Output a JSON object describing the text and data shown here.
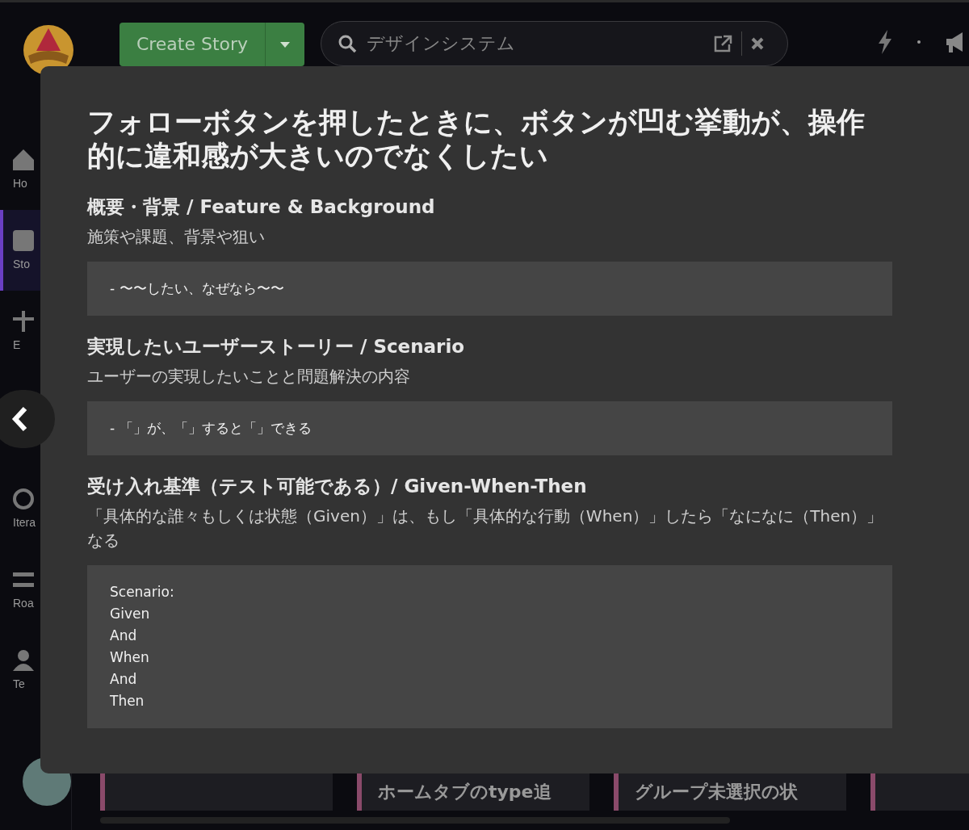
{
  "topbar": {
    "create_button": "Create Story",
    "search": {
      "value": "デザインシステム"
    }
  },
  "sidebar": {
    "items": [
      {
        "label": "Ho",
        "selected": false
      },
      {
        "label": "Sto",
        "selected": true
      },
      {
        "label": "E",
        "selected": false
      },
      {
        "label": "Itera",
        "selected": false
      },
      {
        "label": "Roa",
        "selected": false
      },
      {
        "label": "Te",
        "selected": false
      }
    ]
  },
  "board": {
    "cards": [
      {
        "kind": "blank"
      },
      {
        "kind": "titled",
        "title": "ホームタブのtype追"
      },
      {
        "kind": "titled",
        "title": "グループ未選択の状"
      },
      {
        "kind": "blank"
      }
    ]
  },
  "story": {
    "title": "フォローボタンを押したときに、ボタンが凹む挙動が、操作的に違和感が大きいのでなくしたい",
    "sections": [
      {
        "heading": "概要・背景 / Feature & Background",
        "description": "施策や課題、背景や狙い",
        "lines": [
          "- 〜〜したい、なぜなら〜〜"
        ]
      },
      {
        "heading": "実現したいユーザーストーリー / Scenario",
        "description": "ユーザーの実現したいことと問題解決の内容",
        "lines": [
          "- 「」が、「」すると「」できる"
        ]
      },
      {
        "heading": "受け入れ基準（テスト可能である）/ Given-When-Then",
        "description": "「具体的な誰々もしくは状態（Given）」は、もし「具体的な行動（When）」したら「なになに（Then）」なる",
        "lines": [
          "Scenario:",
          "Given",
          "And",
          "When",
          "And",
          "Then"
        ]
      }
    ]
  }
}
